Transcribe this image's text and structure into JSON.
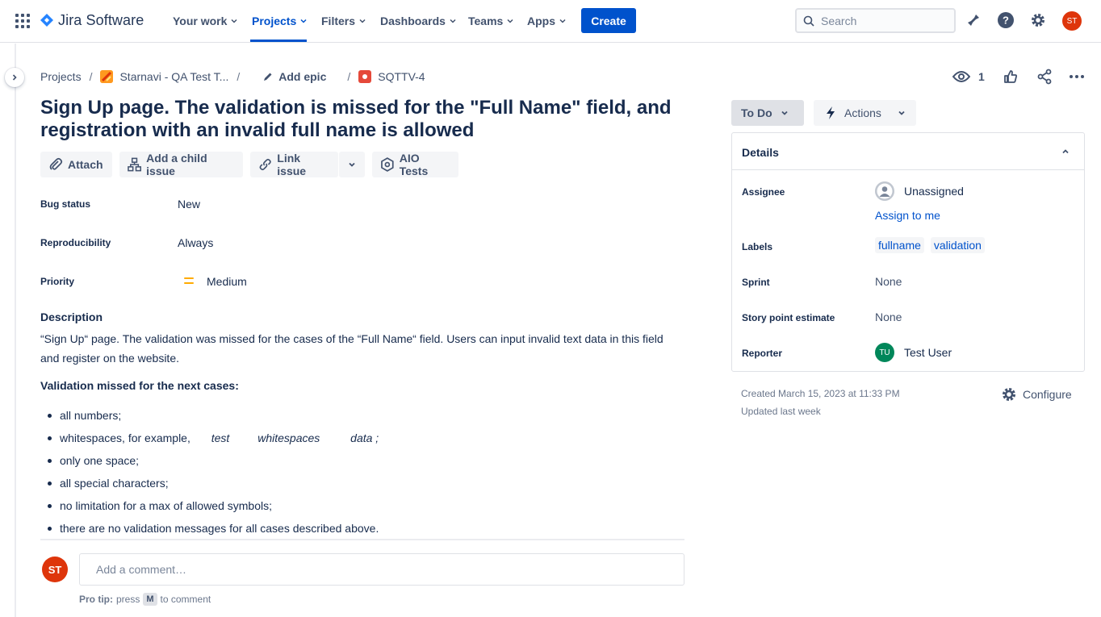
{
  "app": {
    "name": "Jira Software",
    "colors": {
      "brand": "#0052cc",
      "nav_text": "#42526e",
      "bug": "#e5493a",
      "priority_medium": "#ffab00",
      "avatar_user": "#de350b",
      "avatar_reporter": "#00875a"
    }
  },
  "nav": {
    "items": [
      {
        "label": "Your work"
      },
      {
        "label": "Projects",
        "active": true
      },
      {
        "label": "Filters"
      },
      {
        "label": "Dashboards"
      },
      {
        "label": "Teams"
      },
      {
        "label": "Apps"
      }
    ],
    "create_label": "Create",
    "search_placeholder": "Search",
    "user_initials": "ST",
    "icons": [
      "notifications-icon",
      "help-icon",
      "settings-icon"
    ]
  },
  "breadcrumb": {
    "projects": "Projects",
    "project_name": "Starnavi - QA Test T...",
    "epic": "Add epic",
    "issue_key": "SQTTV-4"
  },
  "header_actions": {
    "watchers_count": "1"
  },
  "issue": {
    "title": "Sign Up page. The validation is missed for the \"Full Name\" field, and registration with an invalid full name is allowed",
    "actions": {
      "attach": "Attach",
      "add_child": "Add a child issue",
      "link_issue": "Link issue",
      "aio_tests": "AIO Tests"
    },
    "fields": {
      "bug_status_label": "Bug status",
      "bug_status": "New",
      "reproducibility_label": "Reproducibility",
      "reproducibility": "Always",
      "priority_label": "Priority",
      "priority": "Medium"
    },
    "description": {
      "heading": "Description",
      "text": "“Sign Up“ page. The validation was missed for the cases of the “Full Name“ field. Users can input invalid text data in this field and register on the website.",
      "subheading": "Validation missed for the next cases:",
      "items": [
        "all numbers;",
        "whitespaces, for example,",
        "only one space;",
        "all special characters;",
        "no limitation for a max of allowed symbols;",
        "there are no validation messages for all cases described above."
      ],
      "example_words": [
        "test",
        "whitespaces",
        "data ;"
      ]
    }
  },
  "comment": {
    "avatar_initials": "ST",
    "placeholder": "Add a comment…",
    "pro_tip_bold": "Pro tip:",
    "pro_tip_pre": "press",
    "pro_tip_key": "M",
    "pro_tip_post": "to comment"
  },
  "sidebar_panel": {
    "status": "To Do",
    "actions": "Actions",
    "details_title": "Details",
    "assignee_label": "Assignee",
    "assignee": "Unassigned",
    "assign_to_me": "Assign to me",
    "labels_label": "Labels",
    "labels": [
      "fullname",
      "validation"
    ],
    "sprint_label": "Sprint",
    "sprint": "None",
    "story_points_label": "Story point estimate",
    "story_points": "None",
    "reporter_label": "Reporter",
    "reporter": "Test User",
    "reporter_initials": "TU",
    "created": "Created March 15, 2023 at 11:33 PM",
    "updated": "Updated last week",
    "configure": "Configure"
  }
}
